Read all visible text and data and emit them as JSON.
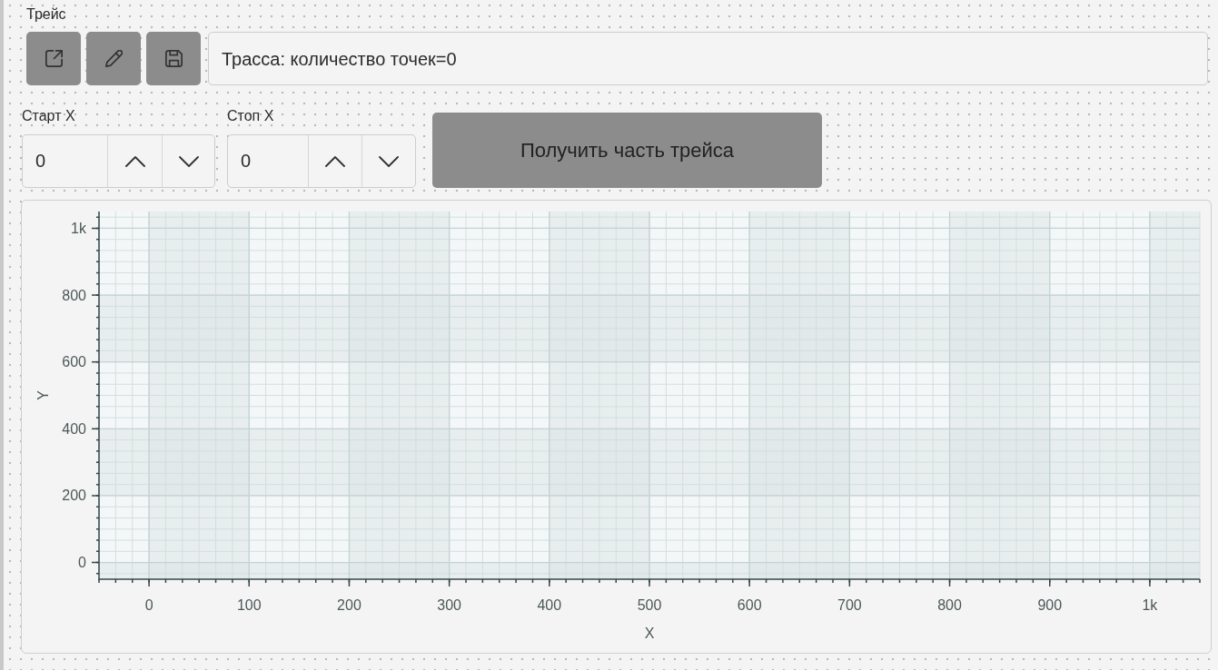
{
  "panel": {
    "title": "Трейс"
  },
  "toolbar": {
    "buttons": [
      {
        "kind": "export"
      },
      {
        "kind": "edit"
      },
      {
        "kind": "save"
      }
    ],
    "info_field": {
      "value": "Трасса: количество точек=0"
    }
  },
  "range_controls": [
    {
      "label": "Старт X",
      "value": "0"
    },
    {
      "label": "Стоп X",
      "value": "0"
    }
  ],
  "fetch_button": {
    "label": "Получить часть трейса"
  },
  "chart": {
    "chart_data": {
      "type": "line",
      "xlabel": "X",
      "ylabel": "Y",
      "xlim": [
        -50,
        1050
      ],
      "ylim": [
        -50,
        1050
      ],
      "xticks": [
        0,
        100,
        200,
        300,
        400,
        500,
        600,
        700,
        800,
        900,
        {
          "value": 1000,
          "label": "1k"
        }
      ],
      "yticks": [
        0,
        200,
        400,
        600,
        800,
        {
          "value": 1000,
          "label": "1k"
        }
      ],
      "grid": true
    }
  }
}
